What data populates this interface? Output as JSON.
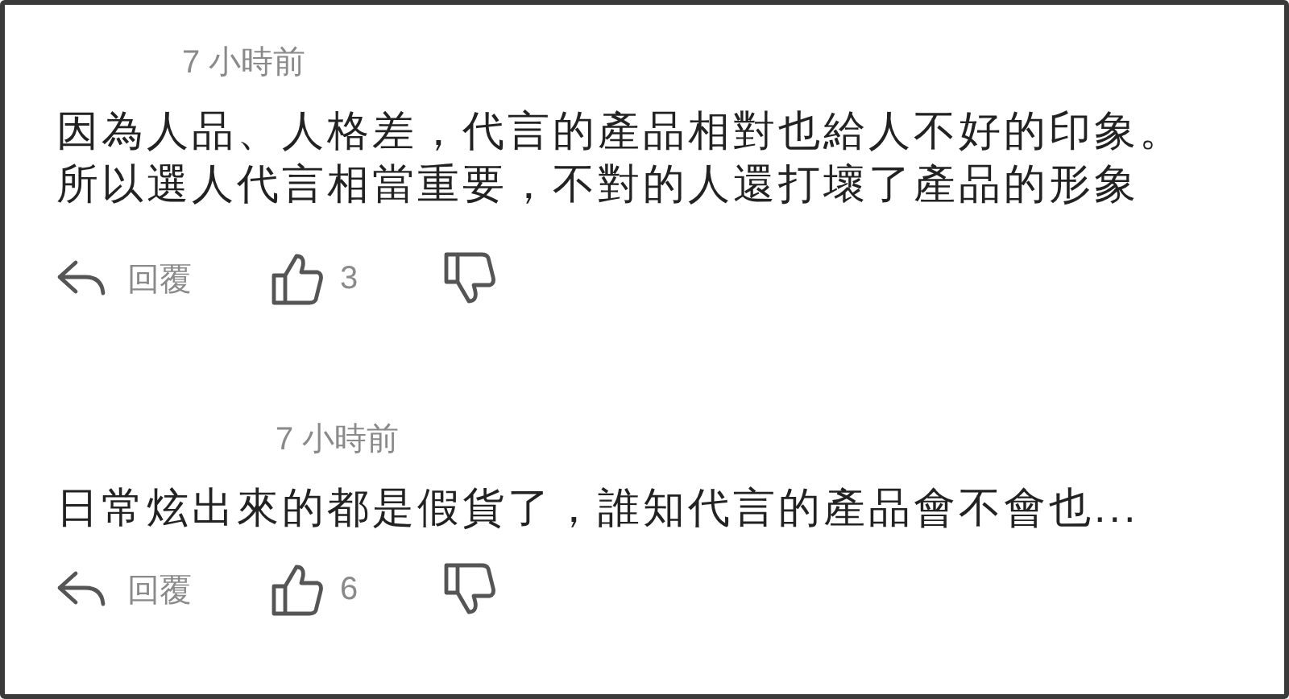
{
  "comments": [
    {
      "time": "7 小時前",
      "text": "因為人品、人格差，代言的產品相對也給人不好的印象。所以選人代言相當重要，不對的人還打壞了產品的形象",
      "reply_label": "回覆",
      "likes": "3"
    },
    {
      "time": "7 小時前",
      "text": "日常炫出來的都是假貨了，誰知代言的產品會不會也...",
      "reply_label": "回覆",
      "likes": "6"
    }
  ]
}
